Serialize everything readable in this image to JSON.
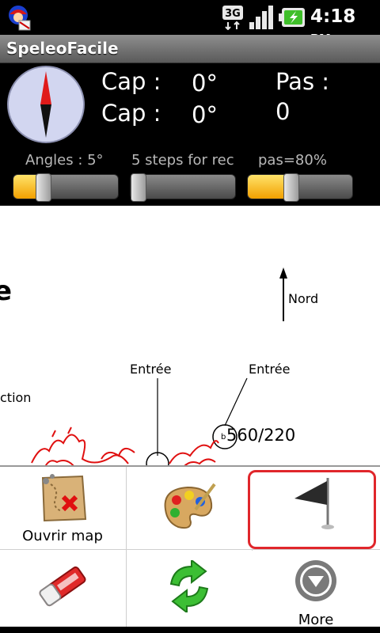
{
  "status_bar": {
    "time": "4:18",
    "ampm": "PM",
    "network": "3G",
    "icons": [
      "notification-icon",
      "network-3g-icon",
      "signal-icon",
      "battery-charging-icon"
    ]
  },
  "app": {
    "title": "SpeleoFacile"
  },
  "readout": {
    "cap_label_1": "Cap :",
    "cap_value_1": "0°",
    "cap_label_2": "Cap :",
    "cap_value_2": "0°",
    "pas_label": "Pas :",
    "pas_value": "0"
  },
  "sliders": [
    {
      "label": "Angles : 5°",
      "level": 0.25
    },
    {
      "label": "5 steps for rec",
      "level": 0.0
    },
    {
      "label": "pas=80%",
      "level": 0.4
    }
  ],
  "map": {
    "north_label": "Nord",
    "entrance_label_1": "Entrée",
    "entrance_label_2": "Entrée",
    "partial_text_1": "e",
    "partial_text_2": "ction",
    "station_label": "560/220",
    "station_prefix": "b",
    "colors": {
      "survey_line": "#e01010",
      "background": "#ffffff"
    }
  },
  "menu": {
    "items": [
      {
        "label": "Ouvrir map",
        "icon": "map-icon"
      },
      {
        "label": "",
        "icon": "palette-icon"
      },
      {
        "label": "",
        "icon": "flag-icon"
      },
      {
        "label": "",
        "icon": "eraser-icon"
      },
      {
        "label": "",
        "icon": "refresh-icon"
      },
      {
        "label": "More",
        "icon": "more-icon"
      }
    ],
    "highlight_color": "#e0262b"
  }
}
